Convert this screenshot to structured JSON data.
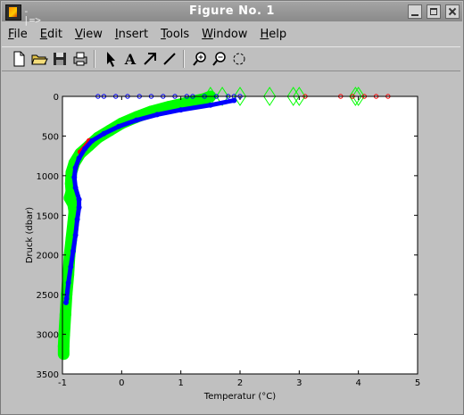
{
  "window": {
    "title": "Figure No. 1",
    "pin_glyph": "-|=>"
  },
  "menu": [
    {
      "label": "File",
      "mnemonic_index": 0
    },
    {
      "label": "Edit",
      "mnemonic_index": 0
    },
    {
      "label": "View",
      "mnemonic_index": 0
    },
    {
      "label": "Insert",
      "mnemonic_index": 0
    },
    {
      "label": "Tools",
      "mnemonic_index": 0
    },
    {
      "label": "Window",
      "mnemonic_index": 0
    },
    {
      "label": "Help",
      "mnemonic_index": 0
    }
  ],
  "toolbar": [
    {
      "icon": "new-file-icon"
    },
    {
      "icon": "open-folder-icon"
    },
    {
      "icon": "save-icon"
    },
    {
      "icon": "print-icon"
    },
    {
      "icon": "select-arrow-icon"
    },
    {
      "icon": "text-insert-icon"
    },
    {
      "icon": "arrow-insert-icon"
    },
    {
      "icon": "line-insert-icon"
    },
    {
      "icon": "zoom-in-icon"
    },
    {
      "icon": "zoom-out-icon"
    },
    {
      "icon": "rotate-icon"
    }
  ],
  "colors": {
    "red": "#ff0000",
    "green": "#00ff00",
    "blue": "#0000ff",
    "figure_bg": "#c0c0c0",
    "axes_bg": "#ffffff"
  },
  "chart_data": {
    "type": "scatter",
    "xlabel": "Temperatur (°C)",
    "ylabel": "Druck (dbar)",
    "xlim": [
      -1,
      5
    ],
    "ylim": [
      0,
      3500
    ],
    "y_reversed": true,
    "xticks": [
      "-1",
      "0",
      "1",
      "2",
      "3",
      "4",
      "5"
    ],
    "yticks": [
      "0",
      "500",
      "1000",
      "1500",
      "2000",
      "2500",
      "3000",
      "3500"
    ],
    "grid": false,
    "series": [
      {
        "color": "red",
        "marker": "o",
        "profile": [
          [
            -0.55,
            560
          ],
          [
            -0.6,
            620
          ],
          [
            -0.7,
            700
          ]
        ],
        "surface": [
          [
            3.1,
            0
          ],
          [
            3.7,
            0
          ],
          [
            3.9,
            0
          ],
          [
            4.1,
            0
          ],
          [
            4.3,
            0
          ],
          [
            4.5,
            0
          ]
        ]
      },
      {
        "color": "green",
        "marker": "diamond",
        "profile": [
          [
            1.5,
            0
          ],
          [
            1.4,
            30
          ],
          [
            1.1,
            80
          ],
          [
            0.8,
            130
          ],
          [
            0.5,
            190
          ],
          [
            0.25,
            260
          ],
          [
            0.0,
            340
          ],
          [
            -0.2,
            430
          ],
          [
            -0.4,
            520
          ],
          [
            -0.55,
            620
          ],
          [
            -0.7,
            720
          ],
          [
            -0.8,
            840
          ],
          [
            -0.85,
            960
          ],
          [
            -0.86,
            1100
          ],
          [
            -0.85,
            1200
          ],
          [
            -0.88,
            1280
          ],
          [
            -0.82,
            1360
          ],
          [
            -0.8,
            1450
          ],
          [
            -0.82,
            1600
          ],
          [
            -0.85,
            1800
          ],
          [
            -0.88,
            2000
          ],
          [
            -0.9,
            2250
          ],
          [
            -0.93,
            2500
          ],
          [
            -0.95,
            2750
          ],
          [
            -0.97,
            3000
          ],
          [
            -0.98,
            3150
          ],
          [
            -0.98,
            3250
          ]
        ],
        "surface": [
          [
            1.5,
            0
          ],
          [
            1.7,
            0
          ],
          [
            2.0,
            0
          ],
          [
            2.5,
            0
          ],
          [
            2.9,
            0
          ],
          [
            3.0,
            0
          ],
          [
            3.95,
            0
          ],
          [
            4.0,
            0
          ]
        ]
      },
      {
        "color": "blue",
        "marker": "o",
        "profile": [
          [
            1.9,
            50
          ],
          [
            1.5,
            110
          ],
          [
            1.0,
            170
          ],
          [
            0.6,
            230
          ],
          [
            0.25,
            300
          ],
          [
            -0.05,
            380
          ],
          [
            -0.3,
            470
          ],
          [
            -0.5,
            560
          ],
          [
            -0.62,
            660
          ],
          [
            -0.72,
            780
          ],
          [
            -0.78,
            900
          ],
          [
            -0.8,
            1020
          ],
          [
            -0.78,
            1150
          ],
          [
            -0.72,
            1300
          ],
          [
            -0.72,
            1400
          ],
          [
            -0.75,
            1550
          ],
          [
            -0.78,
            1750
          ],
          [
            -0.82,
            1950
          ],
          [
            -0.86,
            2150
          ],
          [
            -0.9,
            2350
          ],
          [
            -0.93,
            2550
          ],
          [
            -0.94,
            2600
          ]
        ],
        "surface": [
          [
            -0.4,
            0
          ],
          [
            -0.3,
            0
          ],
          [
            -0.1,
            0
          ],
          [
            0.1,
            0
          ],
          [
            0.3,
            0
          ],
          [
            0.5,
            0
          ],
          [
            0.7,
            0
          ],
          [
            0.9,
            0
          ],
          [
            1.1,
            0
          ],
          [
            1.2,
            0
          ],
          [
            1.4,
            0
          ],
          [
            1.6,
            0
          ],
          [
            1.8,
            0
          ],
          [
            1.9,
            0
          ],
          [
            2.0,
            0
          ]
        ]
      }
    ]
  }
}
